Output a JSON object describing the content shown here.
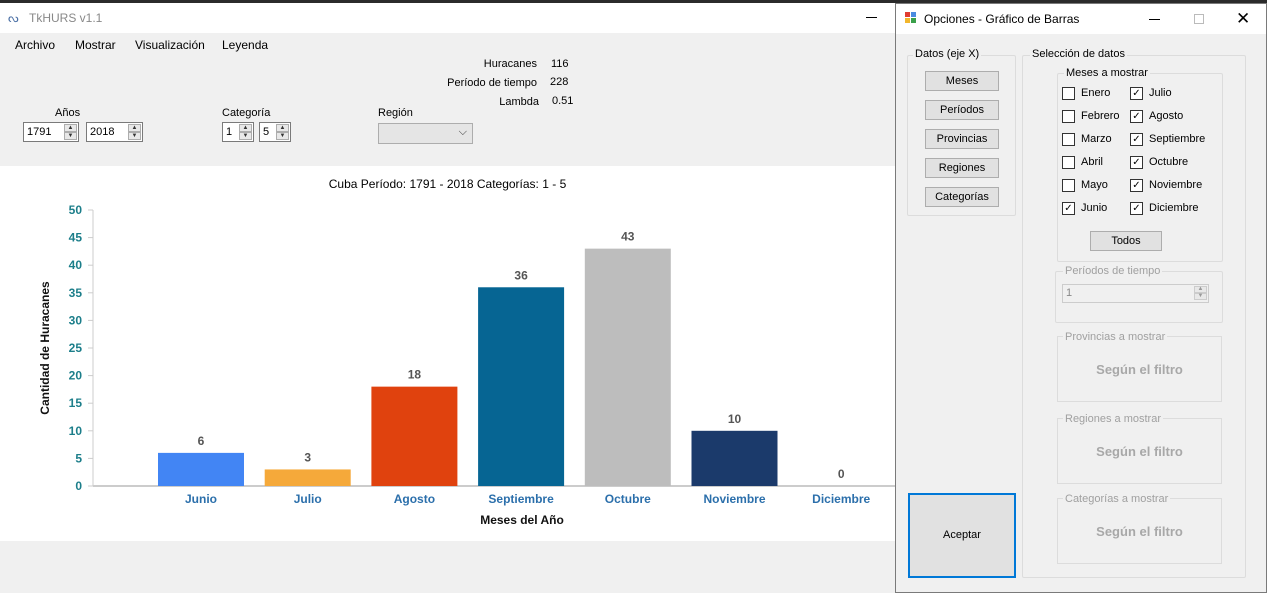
{
  "main": {
    "title": "TkHURS v1.1",
    "menu": [
      "Archivo",
      "Mostrar",
      "Visualización",
      "Leyenda"
    ],
    "stats": [
      {
        "label": "Huracanes",
        "value": "116"
      },
      {
        "label": "Período de tiempo",
        "value": "228"
      },
      {
        "label": "Lambda",
        "value": "0.51"
      }
    ],
    "years_label": "Años",
    "year_from": "1791",
    "year_to": "2018",
    "category_label": "Categoría",
    "cat_from": "1",
    "cat_to": "5",
    "region_label": "Región",
    "region_value": ""
  },
  "chart_data": {
    "type": "bar",
    "title": "Cuba Período: 1791 - 2018 Categorías: 1 - 5",
    "xlabel": "Meses del Año",
    "ylabel": "Cantidad de Huracanes",
    "categories": [
      "Junio",
      "Julio",
      "Agosto",
      "Septiembre",
      "Octubre",
      "Noviembre",
      "Diciembre"
    ],
    "values": [
      6,
      3,
      18,
      36,
      43,
      10,
      0
    ],
    "colors": [
      "#4285f4",
      "#f5a93a",
      "#e0420e",
      "#066593",
      "#bdbdbd",
      "#1b3a6b",
      "#999999"
    ],
    "ylim": [
      0,
      50
    ],
    "yticks": [
      0,
      5,
      10,
      15,
      20,
      25,
      30,
      35,
      40,
      45,
      50
    ],
    "tick_color": "#1c7e8a",
    "xtick_color": "#2b6fab",
    "grid": false
  },
  "dialog": {
    "title": "Opciones - Gráfico de Barras",
    "datos_label": "Datos (eje X)",
    "datos_buttons": [
      "Meses",
      "Períodos",
      "Provincias",
      "Regiones",
      "Categorías"
    ],
    "seleccion_label": "Selección de datos",
    "meses_label": "Meses a mostrar",
    "months_left": [
      {
        "label": "Enero",
        "checked": false
      },
      {
        "label": "Febrero",
        "checked": false
      },
      {
        "label": "Marzo",
        "checked": false
      },
      {
        "label": "Abril",
        "checked": false
      },
      {
        "label": "Mayo",
        "checked": false
      },
      {
        "label": "Junio",
        "checked": true
      }
    ],
    "months_right": [
      {
        "label": "Julio",
        "checked": true
      },
      {
        "label": "Agosto",
        "checked": true
      },
      {
        "label": "Septiembre",
        "checked": true
      },
      {
        "label": "Octubre",
        "checked": true
      },
      {
        "label": "Noviembre",
        "checked": true
      },
      {
        "label": "Diciembre",
        "checked": true
      }
    ],
    "todos_label": "Todos",
    "periodos_label": "Períodos de tiempo",
    "periodos_value": "1",
    "provincias_label": "Provincias a mostrar",
    "regiones_label": "Regiones a mostrar",
    "categorias_label": "Categorías a mostrar",
    "filter_text": "Según el filtro",
    "accept_label": "Aceptar"
  }
}
